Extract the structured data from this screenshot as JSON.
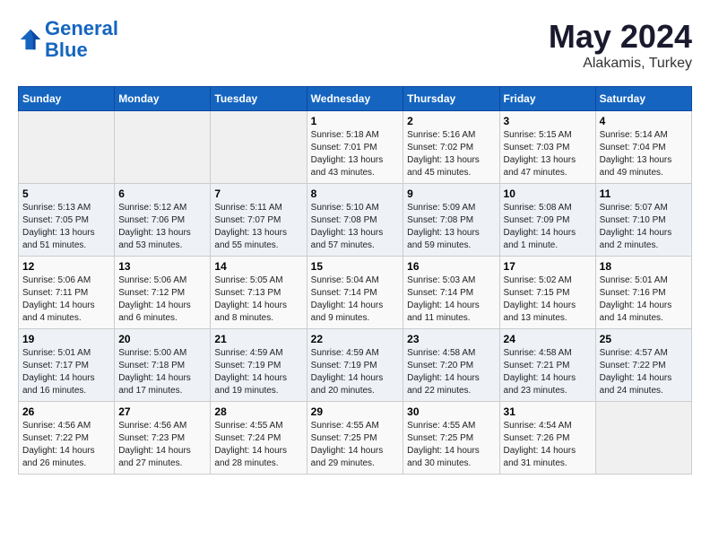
{
  "header": {
    "logo_line1": "General",
    "logo_line2": "Blue",
    "title": "May 2024",
    "subtitle": "Alakamis, Turkey"
  },
  "weekdays": [
    "Sunday",
    "Monday",
    "Tuesday",
    "Wednesday",
    "Thursday",
    "Friday",
    "Saturday"
  ],
  "weeks": [
    [
      {
        "day": "",
        "sunrise": "",
        "sunset": "",
        "daylight": ""
      },
      {
        "day": "",
        "sunrise": "",
        "sunset": "",
        "daylight": ""
      },
      {
        "day": "",
        "sunrise": "",
        "sunset": "",
        "daylight": ""
      },
      {
        "day": "1",
        "sunrise": "Sunrise: 5:18 AM",
        "sunset": "Sunset: 7:01 PM",
        "daylight": "Daylight: 13 hours and 43 minutes."
      },
      {
        "day": "2",
        "sunrise": "Sunrise: 5:16 AM",
        "sunset": "Sunset: 7:02 PM",
        "daylight": "Daylight: 13 hours and 45 minutes."
      },
      {
        "day": "3",
        "sunrise": "Sunrise: 5:15 AM",
        "sunset": "Sunset: 7:03 PM",
        "daylight": "Daylight: 13 hours and 47 minutes."
      },
      {
        "day": "4",
        "sunrise": "Sunrise: 5:14 AM",
        "sunset": "Sunset: 7:04 PM",
        "daylight": "Daylight: 13 hours and 49 minutes."
      }
    ],
    [
      {
        "day": "5",
        "sunrise": "Sunrise: 5:13 AM",
        "sunset": "Sunset: 7:05 PM",
        "daylight": "Daylight: 13 hours and 51 minutes."
      },
      {
        "day": "6",
        "sunrise": "Sunrise: 5:12 AM",
        "sunset": "Sunset: 7:06 PM",
        "daylight": "Daylight: 13 hours and 53 minutes."
      },
      {
        "day": "7",
        "sunrise": "Sunrise: 5:11 AM",
        "sunset": "Sunset: 7:07 PM",
        "daylight": "Daylight: 13 hours and 55 minutes."
      },
      {
        "day": "8",
        "sunrise": "Sunrise: 5:10 AM",
        "sunset": "Sunset: 7:08 PM",
        "daylight": "Daylight: 13 hours and 57 minutes."
      },
      {
        "day": "9",
        "sunrise": "Sunrise: 5:09 AM",
        "sunset": "Sunset: 7:08 PM",
        "daylight": "Daylight: 13 hours and 59 minutes."
      },
      {
        "day": "10",
        "sunrise": "Sunrise: 5:08 AM",
        "sunset": "Sunset: 7:09 PM",
        "daylight": "Daylight: 14 hours and 1 minute."
      },
      {
        "day": "11",
        "sunrise": "Sunrise: 5:07 AM",
        "sunset": "Sunset: 7:10 PM",
        "daylight": "Daylight: 14 hours and 2 minutes."
      }
    ],
    [
      {
        "day": "12",
        "sunrise": "Sunrise: 5:06 AM",
        "sunset": "Sunset: 7:11 PM",
        "daylight": "Daylight: 14 hours and 4 minutes."
      },
      {
        "day": "13",
        "sunrise": "Sunrise: 5:06 AM",
        "sunset": "Sunset: 7:12 PM",
        "daylight": "Daylight: 14 hours and 6 minutes."
      },
      {
        "day": "14",
        "sunrise": "Sunrise: 5:05 AM",
        "sunset": "Sunset: 7:13 PM",
        "daylight": "Daylight: 14 hours and 8 minutes."
      },
      {
        "day": "15",
        "sunrise": "Sunrise: 5:04 AM",
        "sunset": "Sunset: 7:14 PM",
        "daylight": "Daylight: 14 hours and 9 minutes."
      },
      {
        "day": "16",
        "sunrise": "Sunrise: 5:03 AM",
        "sunset": "Sunset: 7:14 PM",
        "daylight": "Daylight: 14 hours and 11 minutes."
      },
      {
        "day": "17",
        "sunrise": "Sunrise: 5:02 AM",
        "sunset": "Sunset: 7:15 PM",
        "daylight": "Daylight: 14 hours and 13 minutes."
      },
      {
        "day": "18",
        "sunrise": "Sunrise: 5:01 AM",
        "sunset": "Sunset: 7:16 PM",
        "daylight": "Daylight: 14 hours and 14 minutes."
      }
    ],
    [
      {
        "day": "19",
        "sunrise": "Sunrise: 5:01 AM",
        "sunset": "Sunset: 7:17 PM",
        "daylight": "Daylight: 14 hours and 16 minutes."
      },
      {
        "day": "20",
        "sunrise": "Sunrise: 5:00 AM",
        "sunset": "Sunset: 7:18 PM",
        "daylight": "Daylight: 14 hours and 17 minutes."
      },
      {
        "day": "21",
        "sunrise": "Sunrise: 4:59 AM",
        "sunset": "Sunset: 7:19 PM",
        "daylight": "Daylight: 14 hours and 19 minutes."
      },
      {
        "day": "22",
        "sunrise": "Sunrise: 4:59 AM",
        "sunset": "Sunset: 7:19 PM",
        "daylight": "Daylight: 14 hours and 20 minutes."
      },
      {
        "day": "23",
        "sunrise": "Sunrise: 4:58 AM",
        "sunset": "Sunset: 7:20 PM",
        "daylight": "Daylight: 14 hours and 22 minutes."
      },
      {
        "day": "24",
        "sunrise": "Sunrise: 4:58 AM",
        "sunset": "Sunset: 7:21 PM",
        "daylight": "Daylight: 14 hours and 23 minutes."
      },
      {
        "day": "25",
        "sunrise": "Sunrise: 4:57 AM",
        "sunset": "Sunset: 7:22 PM",
        "daylight": "Daylight: 14 hours and 24 minutes."
      }
    ],
    [
      {
        "day": "26",
        "sunrise": "Sunrise: 4:56 AM",
        "sunset": "Sunset: 7:22 PM",
        "daylight": "Daylight: 14 hours and 26 minutes."
      },
      {
        "day": "27",
        "sunrise": "Sunrise: 4:56 AM",
        "sunset": "Sunset: 7:23 PM",
        "daylight": "Daylight: 14 hours and 27 minutes."
      },
      {
        "day": "28",
        "sunrise": "Sunrise: 4:55 AM",
        "sunset": "Sunset: 7:24 PM",
        "daylight": "Daylight: 14 hours and 28 minutes."
      },
      {
        "day": "29",
        "sunrise": "Sunrise: 4:55 AM",
        "sunset": "Sunset: 7:25 PM",
        "daylight": "Daylight: 14 hours and 29 minutes."
      },
      {
        "day": "30",
        "sunrise": "Sunrise: 4:55 AM",
        "sunset": "Sunset: 7:25 PM",
        "daylight": "Daylight: 14 hours and 30 minutes."
      },
      {
        "day": "31",
        "sunrise": "Sunrise: 4:54 AM",
        "sunset": "Sunset: 7:26 PM",
        "daylight": "Daylight: 14 hours and 31 minutes."
      },
      {
        "day": "",
        "sunrise": "",
        "sunset": "",
        "daylight": ""
      }
    ]
  ]
}
